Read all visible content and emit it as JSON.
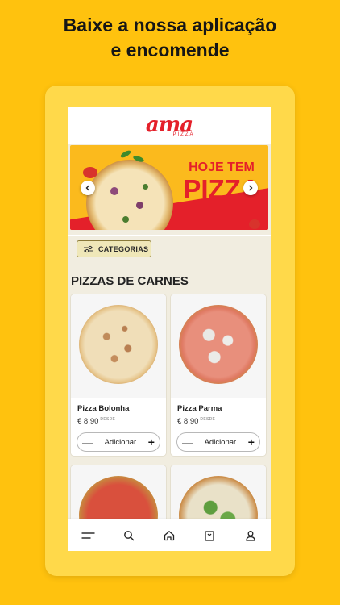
{
  "headline": {
    "line1": "Baixe a nossa aplicação",
    "line2": "e encomende"
  },
  "app": {
    "logo": "ama",
    "logo_sub": "PIZZA",
    "banner": {
      "line1": "HOJE TEM",
      "line2": "PIZZA"
    },
    "categories_label": "CATEGORIAS",
    "section_title": "PIZZAS DE CARNES",
    "products": [
      {
        "name": "Pizza Bolonha",
        "price": "€ 8,90",
        "price_note": "DESDE",
        "add_label": "Adicionar"
      },
      {
        "name": "Pizza Parma",
        "price": "€ 8,90",
        "price_note": "DESDE",
        "add_label": "Adicionar"
      }
    ],
    "bottom_nav": [
      "menu-icon",
      "search-icon",
      "home-icon",
      "bag-icon",
      "user-icon"
    ]
  },
  "colors": {
    "background": "#FFC20E",
    "brand_red": "#E4202A",
    "frame": "#FFD94A"
  }
}
